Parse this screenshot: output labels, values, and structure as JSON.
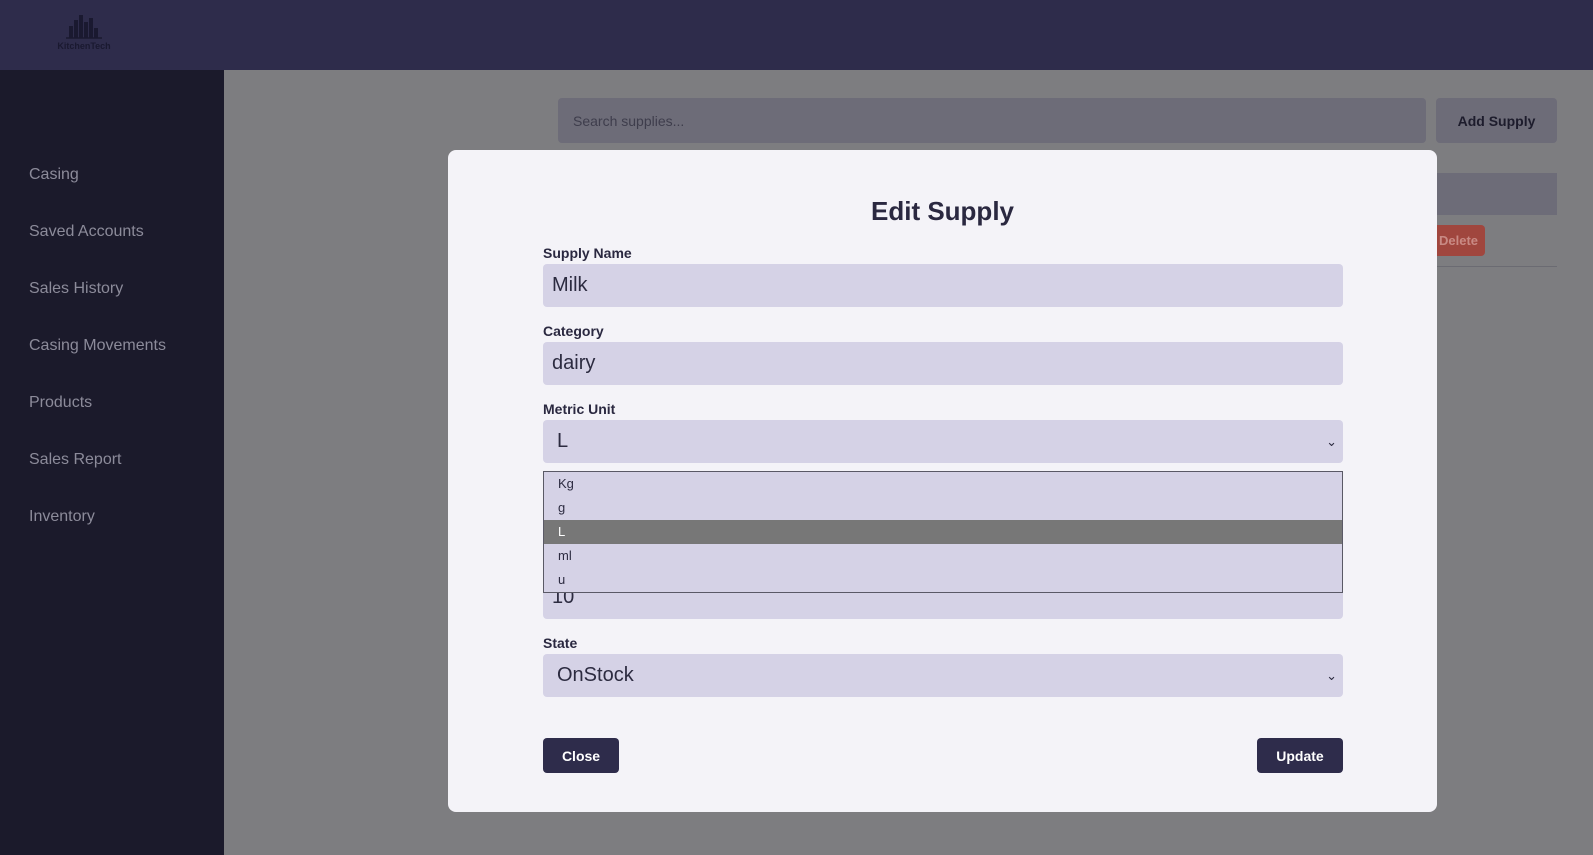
{
  "app": {
    "logo_text": "KitchenTech"
  },
  "sidebar": {
    "items": [
      {
        "label": "Casing"
      },
      {
        "label": "Saved Accounts"
      },
      {
        "label": "Sales History"
      },
      {
        "label": "Casing Movements"
      },
      {
        "label": "Products"
      },
      {
        "label": "Sales Report"
      },
      {
        "label": "Inventory"
      }
    ]
  },
  "main": {
    "search_placeholder": "Search supplies...",
    "add_supply_label": "Add Supply",
    "delete_label": "Delete"
  },
  "modal": {
    "title": "Edit Supply",
    "fields": {
      "supply_name": {
        "label": "Supply Name",
        "value": "Milk"
      },
      "category": {
        "label": "Category",
        "value": "dairy"
      },
      "metric_unit": {
        "label": "Metric Unit",
        "value": "L",
        "options": [
          "Kg",
          "g",
          "L",
          "ml",
          "u"
        ]
      },
      "quantity": {
        "value": "10"
      },
      "state": {
        "label": "State",
        "value": "OnStock"
      }
    },
    "close_label": "Close",
    "update_label": "Update"
  },
  "colors": {
    "topbar": "#2e2c4b",
    "sidebar": "#1b1a2b",
    "overlay": "#7d7d80",
    "modal_bg": "#f4f3f8",
    "input_bg": "#d5d2e6",
    "primary_button": "#2e2c4b",
    "delete_button": "#a0463e"
  }
}
